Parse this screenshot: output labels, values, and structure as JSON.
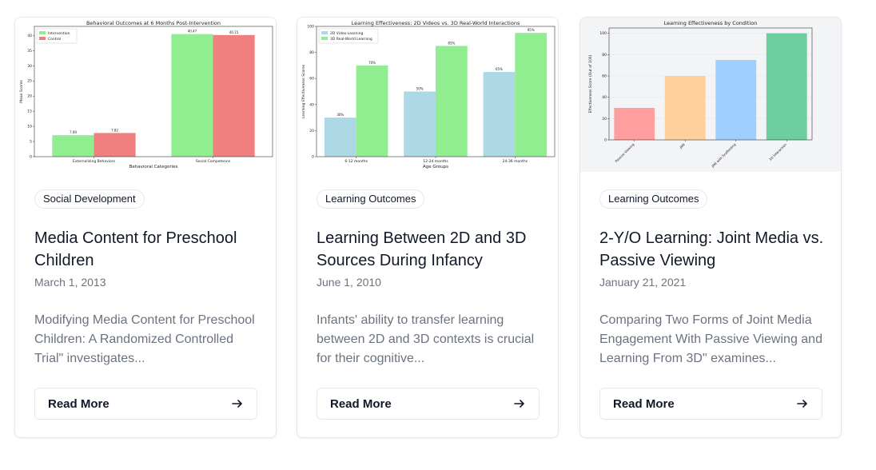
{
  "cards": [
    {
      "tag": "Social Development",
      "title": "Media Content for Preschool Children",
      "date": "March 1, 2013",
      "excerpt": "Modifying Media Content for Preschool Children: A Randomized Controlled Trial\" investigates...",
      "button_label": "Read More",
      "button_icon": "arrow-right-icon"
    },
    {
      "tag": "Learning Outcomes",
      "title": "Learning Between 2D and 3D Sources During Infancy",
      "date": "June 1, 2010",
      "excerpt": "Infants' ability to transfer learning between 2D and 3D contexts is crucial for their cognitive...",
      "button_label": "Read More",
      "button_icon": "arrow-right-icon"
    },
    {
      "tag": "Learning Outcomes",
      "title": "2-Y/O Learning: Joint Media vs. Passive Viewing",
      "date": "January 21, 2021",
      "excerpt": "Comparing Two Forms of Joint Media Engagement With Passive Viewing and Learning From 3D\" examines...",
      "button_label": "Read More",
      "button_icon": "arrow-right-icon"
    }
  ],
  "chart_data": [
    {
      "type": "bar",
      "title": "Behavioral Outcomes at 6 Months Post-Intervention",
      "xlabel": "Behavioral Categories",
      "ylabel": "Mean Scores",
      "categories": [
        "Externalizing Behaviors",
        "Social Competence"
      ],
      "series": [
        {
          "name": "Intervention",
          "values": [
            7.09,
            40.47
          ],
          "color": "#90ee90"
        },
        {
          "name": "Control",
          "values": [
            7.82,
            40.15
          ],
          "color": "#f08080"
        }
      ],
      "data_labels": [
        [
          "7.09",
          "40.47"
        ],
        [
          "7.82",
          "40.15"
        ]
      ],
      "ylim": [
        0,
        43
      ],
      "yticks": [
        "0",
        "5",
        "10",
        "15",
        "20",
        "25",
        "30",
        "35",
        "40"
      ],
      "legend": "top-left",
      "grid": false
    },
    {
      "type": "bar",
      "title": "Learning Effectiveness: 2D Videos vs. 3D Real-World Interactions",
      "xlabel": "Age Groups",
      "ylabel": "Learning Effectiveness Scores",
      "categories": [
        "6-12 months",
        "12-24 months",
        "24-36 months"
      ],
      "series": [
        {
          "name": "2D Video Learning",
          "values": [
            30,
            50,
            65
          ],
          "color": "#add8e6"
        },
        {
          "name": "3D Real-World Learning",
          "values": [
            70,
            85,
            95
          ],
          "color": "#90ee90"
        }
      ],
      "data_labels": [
        [
          "30%",
          "50%",
          "65%"
        ],
        [
          "70%",
          "85%",
          "95%"
        ]
      ],
      "ylim": [
        0,
        100
      ],
      "yticks": [
        "0",
        "20",
        "40",
        "60",
        "80",
        "100"
      ],
      "legend": "top-left",
      "grid": false
    },
    {
      "type": "bar",
      "title": "Learning Effectiveness by Condition",
      "xlabel": "",
      "ylabel": "Effectiveness Score (Out of 100)",
      "categories": [
        "Passive Viewing",
        "JME",
        "JME with Scaffolding",
        "3D Interaction"
      ],
      "values": [
        30,
        60,
        75,
        100
      ],
      "colors": [
        "#ff9999",
        "#ffcc99",
        "#99ccff",
        "#66cc99"
      ],
      "ylim": [
        0,
        105
      ],
      "yticks": [
        "0",
        "20",
        "40",
        "60",
        "80",
        "100"
      ],
      "grid": true
    }
  ]
}
